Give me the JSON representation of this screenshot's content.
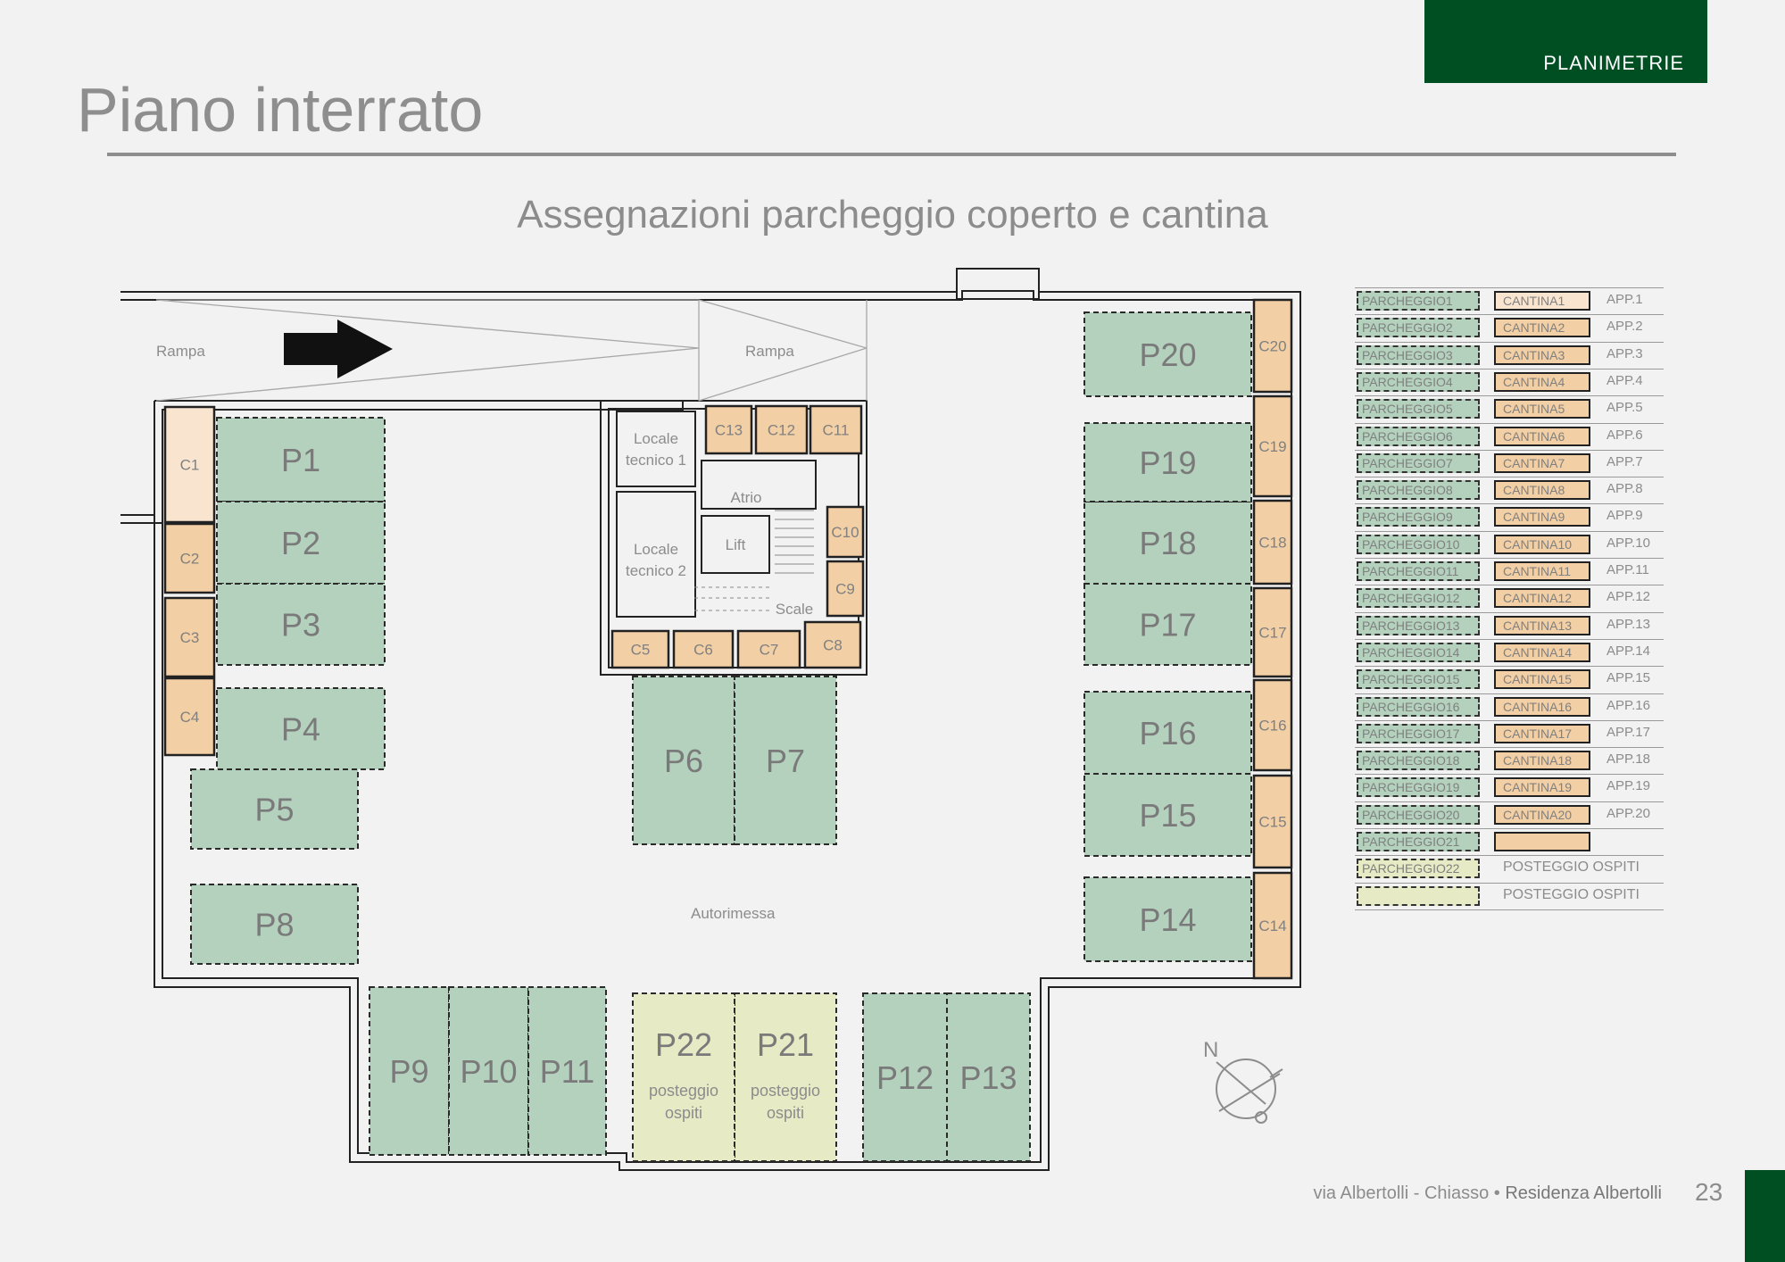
{
  "header": {
    "section_label": "PLANIMETRIE"
  },
  "page": {
    "title": "Piano interrato",
    "subtitle": "Assegnazioni parcheggio coperto e cantina"
  },
  "plan": {
    "labels": {
      "ramp_left": "Rampa",
      "ramp_center": "Rampa",
      "garage": "Autorimessa",
      "technical_room_1": [
        "Locale",
        "tecnico 1"
      ],
      "technical_room_2": [
        "Locale",
        "tecnico 2"
      ],
      "atrium": "Atrio",
      "lift": "Lift",
      "stairs": "Scale",
      "north": "N"
    },
    "parking": [
      {
        "id": "P1",
        "label": "P1",
        "type": "resident"
      },
      {
        "id": "P2",
        "label": "P2",
        "type": "resident"
      },
      {
        "id": "P3",
        "label": "P3",
        "type": "resident"
      },
      {
        "id": "P4",
        "label": "P4",
        "type": "resident"
      },
      {
        "id": "P5",
        "label": "P5",
        "type": "resident"
      },
      {
        "id": "P6",
        "label": "P6",
        "type": "resident"
      },
      {
        "id": "P7",
        "label": "P7",
        "type": "resident"
      },
      {
        "id": "P8",
        "label": "P8",
        "type": "resident"
      },
      {
        "id": "P9",
        "label": "P9",
        "type": "resident"
      },
      {
        "id": "P10",
        "label": "P10",
        "type": "resident"
      },
      {
        "id": "P11",
        "label": "P11",
        "type": "resident"
      },
      {
        "id": "P12",
        "label": "P12",
        "type": "resident"
      },
      {
        "id": "P13",
        "label": "P13",
        "type": "resident"
      },
      {
        "id": "P14",
        "label": "P14",
        "type": "resident"
      },
      {
        "id": "P15",
        "label": "P15",
        "type": "resident"
      },
      {
        "id": "P16",
        "label": "P16",
        "type": "resident"
      },
      {
        "id": "P17",
        "label": "P17",
        "type": "resident"
      },
      {
        "id": "P18",
        "label": "P18",
        "type": "resident"
      },
      {
        "id": "P19",
        "label": "P19",
        "type": "resident"
      },
      {
        "id": "P20",
        "label": "P20",
        "type": "resident"
      },
      {
        "id": "P21",
        "label": "P21",
        "type": "guest",
        "sub": [
          "posteggio",
          "ospiti"
        ]
      },
      {
        "id": "P22",
        "label": "P22",
        "type": "guest",
        "sub": [
          "posteggio",
          "ospiti"
        ]
      }
    ],
    "cellars": [
      "C1",
      "C2",
      "C3",
      "C4",
      "C5",
      "C6",
      "C7",
      "C8",
      "C9",
      "C10",
      "C11",
      "C12",
      "C13",
      "C14",
      "C15",
      "C16",
      "C17",
      "C18",
      "C19",
      "C20"
    ]
  },
  "legend": {
    "rows": [
      {
        "parking": "PARCHEGGIO1",
        "cellar": "CANTINA1",
        "app": "APP.1"
      },
      {
        "parking": "PARCHEGGIO2",
        "cellar": "CANTINA2",
        "app": "APP.2"
      },
      {
        "parking": "PARCHEGGIO3",
        "cellar": "CANTINA3",
        "app": "APP.3"
      },
      {
        "parking": "PARCHEGGIO4",
        "cellar": "CANTINA4",
        "app": "APP.4"
      },
      {
        "parking": "PARCHEGGIO5",
        "cellar": "CANTINA5",
        "app": "APP.5"
      },
      {
        "parking": "PARCHEGGIO6",
        "cellar": "CANTINA6",
        "app": "APP.6"
      },
      {
        "parking": "PARCHEGGIO7",
        "cellar": "CANTINA7",
        "app": "APP.7"
      },
      {
        "parking": "PARCHEGGIO8",
        "cellar": "CANTINA8",
        "app": "APP.8"
      },
      {
        "parking": "PARCHEGGIO9",
        "cellar": "CANTINA9",
        "app": "APP.9"
      },
      {
        "parking": "PARCHEGGIO10",
        "cellar": "CANTINA10",
        "app": "APP.10"
      },
      {
        "parking": "PARCHEGGIO11",
        "cellar": "CANTINA11",
        "app": "APP.11"
      },
      {
        "parking": "PARCHEGGIO12",
        "cellar": "CANTINA12",
        "app": "APP.12"
      },
      {
        "parking": "PARCHEGGIO13",
        "cellar": "CANTINA13",
        "app": "APP.13"
      },
      {
        "parking": "PARCHEGGIO14",
        "cellar": "CANTINA14",
        "app": "APP.14"
      },
      {
        "parking": "PARCHEGGIO15",
        "cellar": "CANTINA15",
        "app": "APP.15"
      },
      {
        "parking": "PARCHEGGIO16",
        "cellar": "CANTINA16",
        "app": "APP.16"
      },
      {
        "parking": "PARCHEGGIO17",
        "cellar": "CANTINA17",
        "app": "APP.17"
      },
      {
        "parking": "PARCHEGGIO18",
        "cellar": "CANTINA18",
        "app": "APP.18"
      },
      {
        "parking": "PARCHEGGIO19",
        "cellar": "CANTINA19",
        "app": "APP.19"
      },
      {
        "parking": "PARCHEGGIO20",
        "cellar": "CANTINA20",
        "app": "APP.20"
      },
      {
        "parking": "PARCHEGGIO21",
        "cellar": "",
        "app": ""
      }
    ],
    "guest_rows": [
      {
        "parking": "PARCHEGGIO22",
        "note": "POSTEGGIO OSPITI"
      },
      {
        "parking": "",
        "note": "POSTEGGIO OSPITI"
      }
    ]
  },
  "footer": {
    "address": "via Albertolli - Chiasso",
    "separator": " • ",
    "project": "Residenza Albertolli",
    "page_number": "23"
  },
  "colors": {
    "brand_green": "#004f23",
    "parking_fill": "#b4d1bd",
    "guest_fill": "#e6ebc5",
    "cellar_fill": "#f2cfa4",
    "cellar_first_fill": "#f9e5cf"
  }
}
